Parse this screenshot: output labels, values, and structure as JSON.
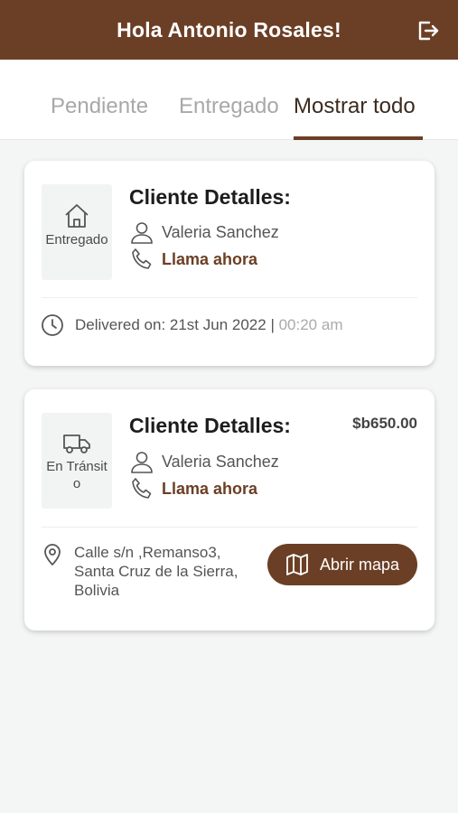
{
  "header": {
    "title": "Hola Antonio Rosales!",
    "logout_icon": "logout-icon"
  },
  "tabs": [
    {
      "label": "Pendiente",
      "active": false
    },
    {
      "label": "Entregado",
      "active": false
    },
    {
      "label": "Mostrar todo",
      "active": true
    }
  ],
  "orders": [
    {
      "status_icon": "home-icon",
      "status": "Entregado",
      "title": "Cliente Detalles:",
      "client_name": "Valeria Sanchez",
      "call_label": "Llama ahora",
      "delivered_prefix": "Delivered on: 21st Jun 2022",
      "delivered_separator": "|",
      "delivered_time": "00:20 am"
    },
    {
      "status_icon": "truck-icon",
      "status": "En Tránsito",
      "title": "Cliente Detalles:",
      "price": "$b650.00",
      "client_name": "Valeria Sanchez",
      "call_label": "Llama ahora",
      "address": "Calle s/n ,Remanso3, Santa Cruz de la Sierra, Bolivia",
      "map_button_label": "Abrir mapa"
    }
  ],
  "colors": {
    "brand": "#6b3f25",
    "background": "#f4f5f5",
    "muted_text": "#a8a8a8"
  }
}
